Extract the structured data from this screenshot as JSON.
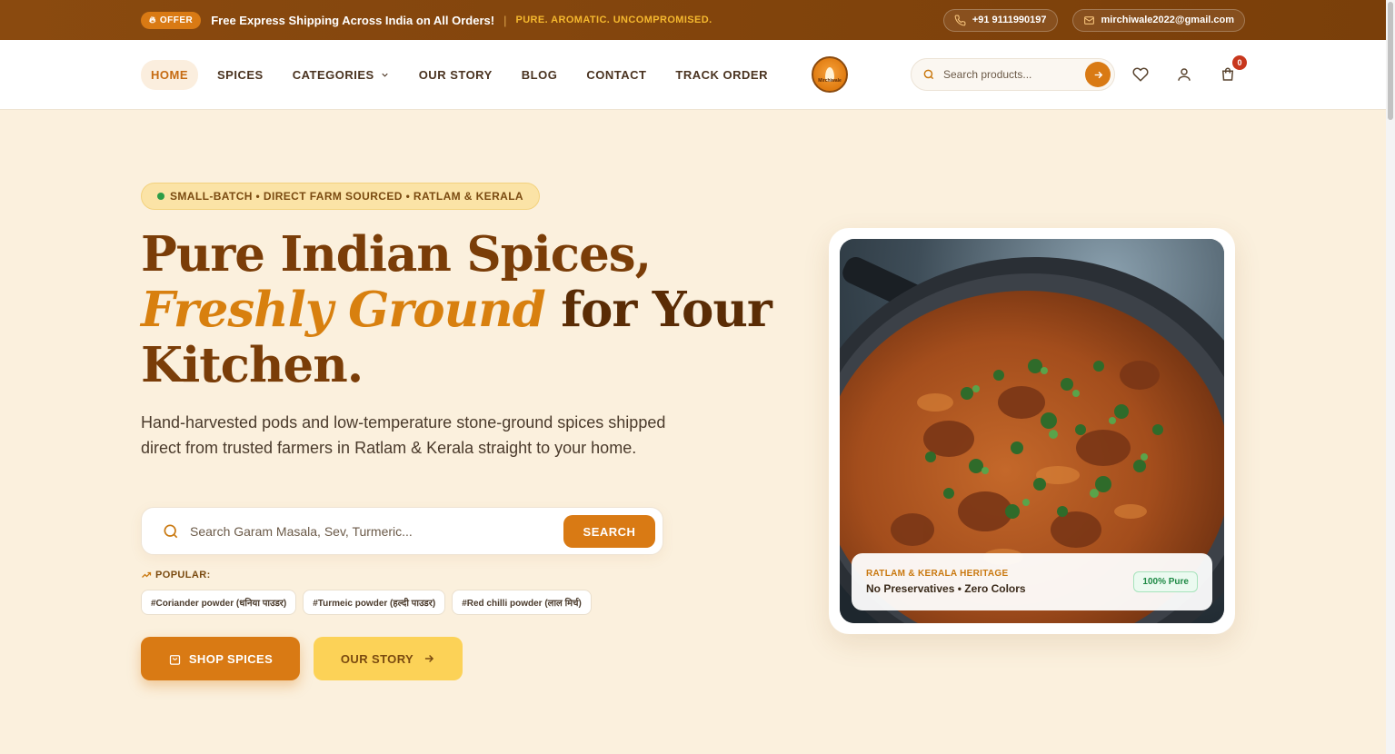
{
  "topbar": {
    "offer_label": "OFFER",
    "promo_text": "Free Express Shipping Across India on All Orders!",
    "separator": "|",
    "tagline": "PURE. AROMATIC. UNCOMPROMISED.",
    "phone": "+91 9111990197",
    "email": "mirchiwale2022@gmail.com"
  },
  "nav": {
    "items": [
      {
        "label": "HOME"
      },
      {
        "label": "SPICES"
      },
      {
        "label": "CATEGORIES"
      },
      {
        "label": "OUR STORY"
      },
      {
        "label": "BLOG"
      },
      {
        "label": "CONTACT"
      },
      {
        "label": "TRACK ORDER"
      }
    ],
    "search_placeholder": "Search products...",
    "cart_count": "0",
    "logo_text": "Mirchiwale"
  },
  "hero": {
    "badge": "SMALL-BATCH • DIRECT FARM SOURCED • RATLAM & KERALA",
    "title_line1": "Pure Indian Spices,",
    "title_accent": "Freshly Ground",
    "title_line2_rest": " for Your",
    "title_line3": "Kitchen.",
    "subtitle": "Hand-harvested pods and low-temperature stone-ground spices shipped direct from trusted farmers in Ratlam & Kerala straight to your home.",
    "search_placeholder": "Search Garam Masala, Sev, Turmeric...",
    "search_button": "SEARCH",
    "popular_label": "POPULAR:",
    "tags": [
      "#Coriander powder (धनिया पाउडर)",
      "#Turmeic powder (हल्दी पाउडर)",
      "#Red chilli powder (लाल मिर्च)"
    ],
    "shop_button": "SHOP SPICES",
    "story_button": "OUR STORY"
  },
  "image_card": {
    "heritage_label": "RATLAM & KERALA HERITAGE",
    "features": "No Preservatives • Zero Colors",
    "pure_badge": "100% Pure"
  },
  "colors": {
    "brand_orange": "#d97a14",
    "brand_brown": "#7a3d08",
    "topbar_bg": "#8a4a0f",
    "page_bg": "#fbf0dd",
    "yellow_button": "#fcd257"
  }
}
